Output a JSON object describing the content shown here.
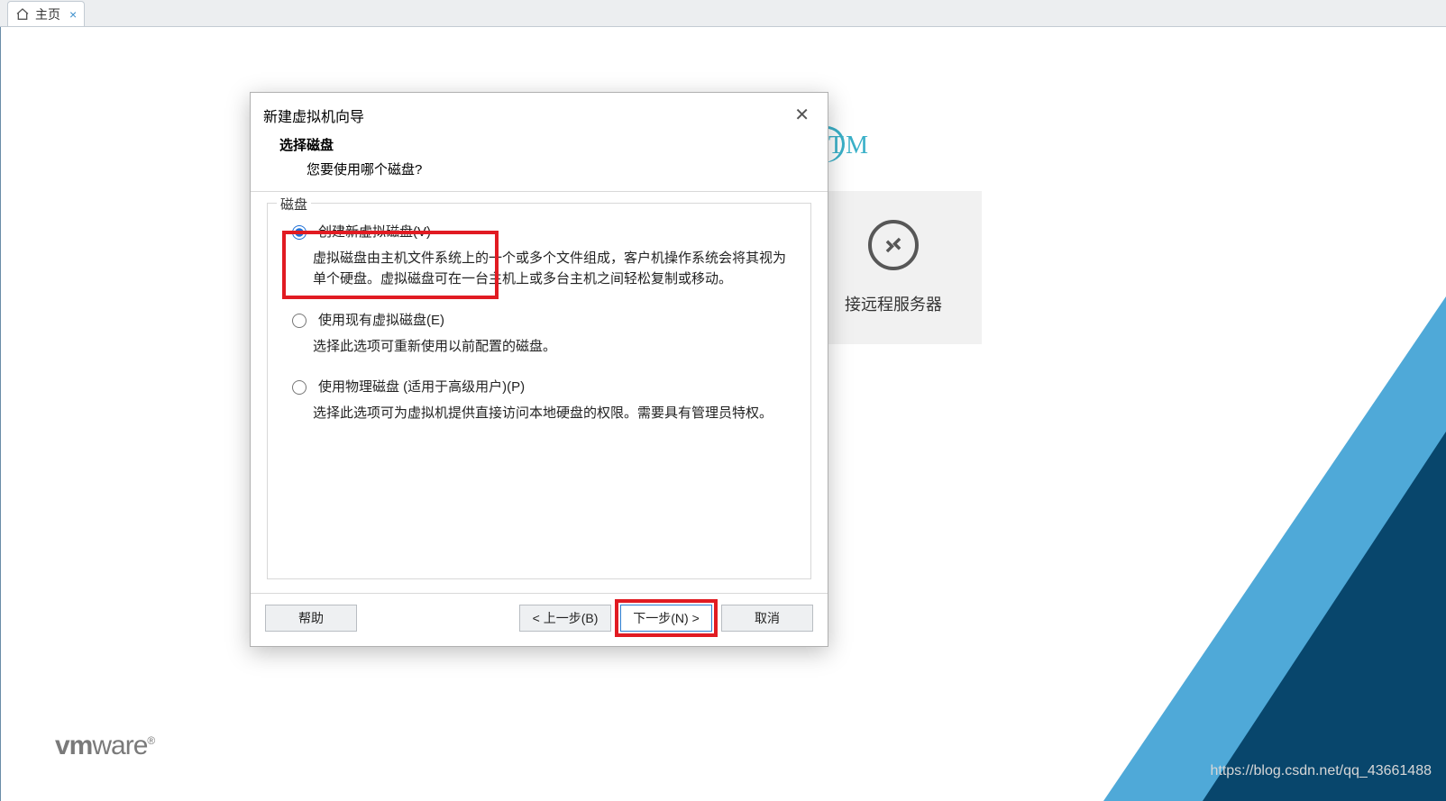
{
  "tab": {
    "label": "主页"
  },
  "background": {
    "tm": "TM",
    "card_label": "接远程服务器",
    "vmware": "vmware",
    "watermark": "https://blog.csdn.net/qq_43661488"
  },
  "dialog": {
    "title": "新建虚拟机向导",
    "sub_heading": "选择磁盘",
    "sub_question": "您要使用哪个磁盘?",
    "group_legend": "磁盘",
    "options": [
      {
        "selected": true,
        "label": "创建新虚拟磁盘(V)",
        "desc": "虚拟磁盘由主机文件系统上的一个或多个文件组成，客户机操作系统会将其视为单个硬盘。虚拟磁盘可在一台主机上或多台主机之间轻松复制或移动。"
      },
      {
        "selected": false,
        "label": "使用现有虚拟磁盘(E)",
        "desc": "选择此选项可重新使用以前配置的磁盘。"
      },
      {
        "selected": false,
        "label": "使用物理磁盘 (适用于高级用户)(P)",
        "desc": "选择此选项可为虚拟机提供直接访问本地硬盘的权限。需要具有管理员特权。"
      }
    ],
    "buttons": {
      "help": "帮助",
      "back": "< 上一步(B)",
      "next": "下一步(N) >",
      "cancel": "取消"
    }
  }
}
